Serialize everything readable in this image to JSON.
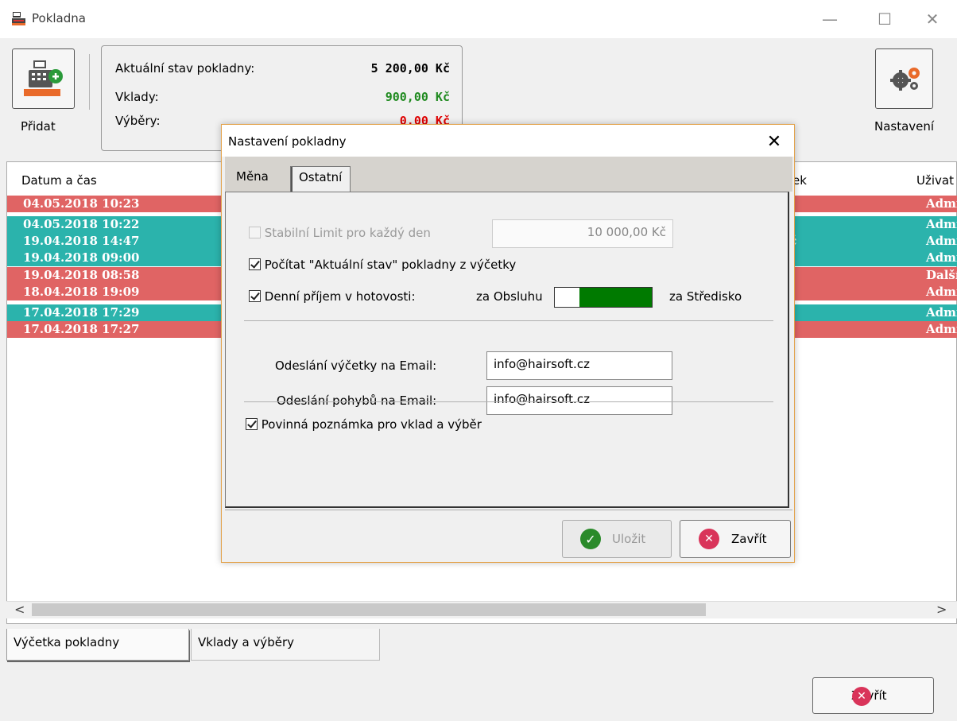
{
  "window": {
    "title": "Pokladna",
    "minimize": "—",
    "maximize": "☐",
    "close": "✕"
  },
  "toolbar": {
    "add_label": "Přidat",
    "settings_label": "Nastavení"
  },
  "balance": {
    "current_label": "Aktuální stav pokladny:",
    "current_value": "5 200,00 Kč",
    "deposits_label": "Vklady:",
    "deposits_value": "900,00 Kč",
    "withdrawals_label": "Výběry:",
    "withdrawals_value": "0,00 Kč"
  },
  "colors": {
    "red_row": "#e06464",
    "teal_row": "#2bb3ac",
    "deposit_green": "#1f8a1f",
    "withdraw_red": "#e00000",
    "toggle_green": "#007a00",
    "dialog_border": "#e3a24a"
  },
  "grid": {
    "columns": [
      "Datum a čas",
      "ek",
      "Uživat"
    ],
    "rows": [
      {
        "date": "04.05.2018 10:23",
        "user": "Admi",
        "color": "red"
      },
      {
        "date": "04.05.2018 10:22",
        "user": "Admi",
        "color": "teal"
      },
      {
        "date": "19.04.2018 14:47",
        "user": "Admi",
        "color": "teal",
        "mid": "č"
      },
      {
        "date": "19.04.2018 09:00",
        "user": "Admi",
        "color": "teal"
      },
      {
        "date": "19.04.2018 08:58",
        "user": "Další",
        "color": "red"
      },
      {
        "date": "18.04.2018 19:09",
        "user": "Admi",
        "color": "red"
      },
      {
        "date": "17.04.2018 17:29",
        "user": "Admi",
        "color": "teal"
      },
      {
        "date": "17.04.2018 17:27",
        "user": "Admi",
        "color": "red"
      }
    ]
  },
  "scroll": {
    "left": "<",
    "right": ">"
  },
  "bottom_tabs": [
    "Výčetka pokladny",
    "Vklady a výběry"
  ],
  "main_close_label": "Zavřít",
  "dialog": {
    "title": "Nastavení pokladny",
    "close": "✕",
    "tabs": [
      "Měna",
      "Ostatní"
    ],
    "stable_limit_label": "Stabilní Limit pro každý den",
    "stable_limit_value": "10 000,00 Kč",
    "compute_label": "Počítat \"Aktuální stav\" pokladny z výčetky",
    "daily_income_label": "Denní příjem v hotovosti:",
    "toggle_left": "za Obsluhu",
    "toggle_right": "za Středisko",
    "email_count_label": "Odeslání výčetky na Email:",
    "email_count_value": "info@hairsoft.cz",
    "email_moves_label": "Odeslání pohybů na Email:",
    "email_moves_value": "info@hairsoft.cz",
    "mandatory_note_label": "Povinná poznámka pro vklad a výběr",
    "save_label": "Uložit",
    "close_label": "Zavřít"
  }
}
